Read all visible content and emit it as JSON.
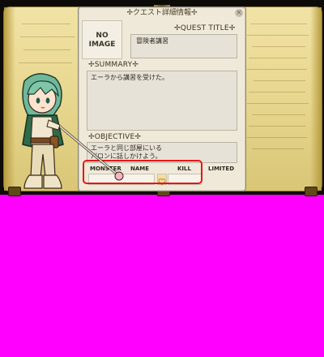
{
  "window": {
    "title": "✢クエスト詳細情報✢",
    "close": "×"
  },
  "image_box": {
    "line1": "NO",
    "line2": "IMAGE"
  },
  "quest_title": {
    "label": "✢QUEST  TITLE✢",
    "value": "冒険者講習"
  },
  "summary": {
    "label": "✢SUMMARY✢",
    "text": "エーラから講習を受けた。"
  },
  "objective": {
    "label": "✢OBJECTIVE✢",
    "line1": "エーラと同じ部屋にいる",
    "line2": "パロンに話しかけよう。"
  },
  "monster_table": {
    "col_monster": "MONSTER",
    "col_name": "NAME",
    "col_kill": "KILL",
    "col_limited": "LIMITED"
  },
  "colors": {
    "highlight": "#e81515",
    "background": "#ff00ff"
  }
}
